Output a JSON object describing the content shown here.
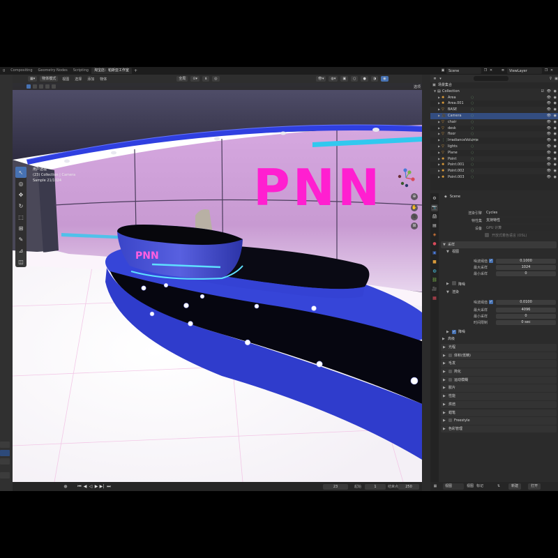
{
  "workspace": {
    "tabs": [
      "g",
      "Compositing",
      "Geometry Nodes",
      "Scripting",
      "淘宝店：帕斯亚工作室"
    ],
    "active_tab": 4,
    "add": "+",
    "scene": "Scene",
    "view_layer": "ViewLayer"
  },
  "viewport": {
    "mode": "物体模式",
    "menus": [
      "视图",
      "选择",
      "添加",
      "物体"
    ],
    "orientation": "全局",
    "options": "选项",
    "info_line1": "用户透视",
    "info_line2": "(23) Collection | Camera",
    "info_line3": "Sample 21/1024",
    "set_text": "PNN",
    "desk_text": "PNN",
    "colors": {
      "wall_pink": "#c99ad6",
      "led_blue": "#2f3fe0",
      "neon_magenta": "#ff1fd0",
      "neon_cyan": "#31c8ef",
      "floor": "#ffffff",
      "ceiling": "#3a3850"
    }
  },
  "timeline": {
    "current_frame": "23",
    "start_label": "起始",
    "start": "1",
    "end_label": "结束点",
    "end": "250",
    "menus": [
      "视图",
      "标记"
    ],
    "new_btn": "新建",
    "open_btn": "打开"
  },
  "outliner": {
    "root": "场景集合",
    "collection": "Collection",
    "items": [
      {
        "name": "Area",
        "icon": "light-icon",
        "color": "#e8a33b"
      },
      {
        "name": "Area.001",
        "icon": "light-icon",
        "color": "#e8a33b"
      },
      {
        "name": "BASE",
        "icon": "mesh-icon",
        "color": "#e8a33b"
      },
      {
        "name": "Camera",
        "icon": "camera-icon",
        "color": "#e8a33b",
        "selected": true
      },
      {
        "name": "chair",
        "icon": "mesh-icon",
        "color": "#e8a33b"
      },
      {
        "name": "desk",
        "icon": "mesh-icon",
        "color": "#e8a33b"
      },
      {
        "name": "floor",
        "icon": "mesh-icon",
        "color": "#e8a33b"
      },
      {
        "name": "IrradianceVolume",
        "icon": "probe-icon",
        "color": "#7fb37f"
      },
      {
        "name": "lights",
        "icon": "mesh-icon",
        "color": "#e8a33b"
      },
      {
        "name": "Plane",
        "icon": "mesh-icon",
        "color": "#e8a33b"
      },
      {
        "name": "Point",
        "icon": "light-icon",
        "color": "#e8a33b"
      },
      {
        "name": "Point.001",
        "icon": "light-icon",
        "color": "#e8a33b"
      },
      {
        "name": "Point.002",
        "icon": "light-icon",
        "color": "#e8a33b"
      },
      {
        "name": "Point.003",
        "icon": "light-icon",
        "color": "#e8a33b"
      }
    ]
  },
  "properties": {
    "scene": "Scene",
    "render_engine_label": "渲染引擎",
    "render_engine": "Cycles",
    "feature_set_label": "特性集",
    "feature_set": "支持特性",
    "device_label": "设备",
    "device": "GPU 计算",
    "osl": "开放式着色语言 (OSL)",
    "sampling": "采样",
    "viewport": "视图",
    "noise_threshold_label": "噪波阈值",
    "vp_noise_threshold": "0.1000",
    "max_samples_label": "最大采样",
    "vp_max_samples": "1024",
    "min_samples_label": "最小采样",
    "vp_min_samples": "0",
    "denoise": "降噪",
    "render": "渲染",
    "r_noise_threshold": "0.0100",
    "r_max_samples": "4096",
    "r_min_samples": "0",
    "time_limit_label": "时间限制",
    "r_time_limit": "0 sec",
    "denoise2": "降噪",
    "advanced": "高级",
    "panels": [
      "光程",
      "体积(低精)",
      "毛发",
      "简化",
      "运动模糊",
      "胶片",
      "性能",
      "烘焙",
      "蜡笔",
      "Freestyle",
      "色彩管理"
    ]
  }
}
